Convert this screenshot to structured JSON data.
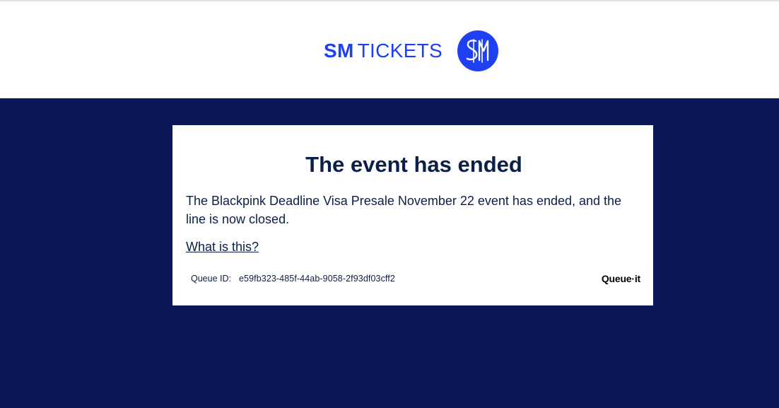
{
  "brand": {
    "sm_text": "SM",
    "tickets_text": "TICKETS",
    "badge_icon": "sm-badge-icon",
    "brand_color": "#1f3ff2",
    "page_bg": "#0a1857"
  },
  "card": {
    "title": "The event has ended",
    "message": "The Blackpink Deadline Visa Presale November 22 event has ended, and the line is now closed.",
    "help_link": "What is this?",
    "queue_id_label": "Queue ID:",
    "queue_id_value": "e59fb323-485f-44ab-9058-2f93df03cff2",
    "provider_logo": "Queue·it"
  }
}
